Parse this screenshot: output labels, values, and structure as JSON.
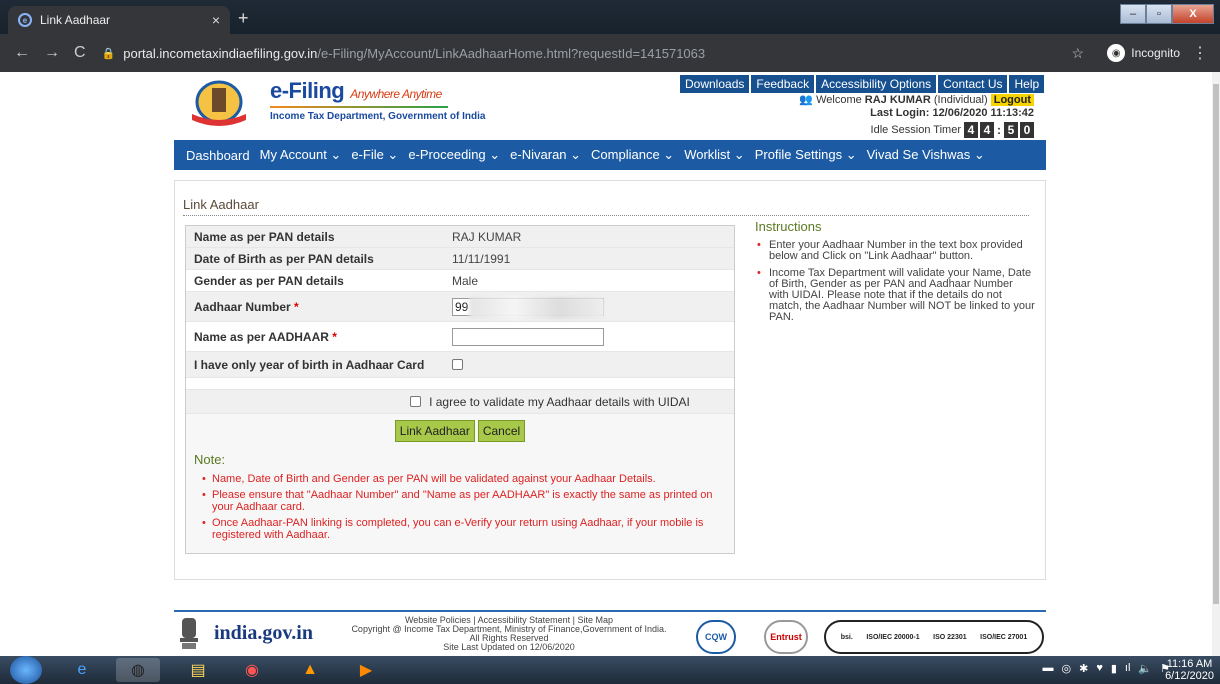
{
  "browser": {
    "tab_title": "Link Aadhaar",
    "tab_close": "×",
    "new_tab": "+",
    "url_domain": "portal.incometaxindiaefiling.gov.in",
    "url_path": "/e-Filing/MyAccount/LinkAadhaarHome.html?requestId=141571063",
    "incognito_label": "Incognito"
  },
  "header": {
    "brand_title": "e-Filing",
    "brand_tagline": "Anywhere Anytime",
    "brand_subtitle": "Income Tax Department, Government of India",
    "top_links": [
      "Downloads",
      "Feedback",
      "Accessibility Options",
      "Contact Us",
      "Help"
    ],
    "welcome_prefix": "Welcome",
    "user_name": "RAJ KUMAR",
    "user_type": "(Individual)",
    "logout_label": "Logout",
    "last_login": "Last Login: 12/06/2020 11:13:42",
    "idle_label": "Idle Session Timer",
    "timer_digits": [
      "4",
      "4",
      ":",
      "5",
      "0"
    ]
  },
  "nav": {
    "items": [
      "Dashboard",
      "My Account ⌄",
      "e-File ⌄",
      "e-Proceeding ⌄",
      "e-Nivaran ⌄",
      "Compliance ⌄",
      "Worklist ⌄",
      "Profile Settings ⌄",
      "Vivad Se Vishwas ⌄"
    ]
  },
  "content": {
    "title": "Link Aadhaar",
    "rows": [
      {
        "label": "Name as per PAN details",
        "value": "RAJ KUMAR"
      },
      {
        "label": "Date of Birth as per PAN details",
        "value": "11/11/1991"
      },
      {
        "label": "Gender as per PAN details",
        "value": "Male"
      }
    ],
    "aadhaar_label": "Aadhaar Number",
    "aadhaar_value": "99",
    "name_aadhaar_label": "Name as per AADHAAR",
    "yob_label": "I have only year of birth in Aadhaar Card",
    "agree_label": "I agree to validate my Aadhaar details with UIDAI",
    "link_button": "Link Aadhaar",
    "cancel_button": "Cancel",
    "note_title": "Note:",
    "notes": [
      "Name, Date of Birth and Gender as per PAN will be validated against your Aadhaar Details.",
      "Please ensure that \"Aadhaar Number\" and \"Name as per AADHAAR\" is exactly the same as printed on your Aadhaar card.",
      "Once Aadhaar-PAN linking is completed, you can e-Verify your return using Aadhaar, if your mobile is registered with Aadhaar."
    ],
    "instructions_title": "Instructions",
    "instructions": [
      "Enter your Aadhaar Number in the text box provided below and Click on \"Link Aadhaar\" button.",
      "Income Tax Department will validate your Name, Date of Birth, Gender as per PAN and Aadhaar Number with UIDAI. Please note that if the details do not match, the Aadhaar Number will NOT be linked to your PAN."
    ]
  },
  "footer": {
    "gov_site": "india.gov.in",
    "links": "Website Policies | Accessibility Statement | Site Map",
    "copyright": "Copyright @ Income Tax Department, Ministry of Finance,Government of India.",
    "rights": "All Rights Reserved",
    "updated": "Site Last Updated on 12/06/2020",
    "cert_cqw": "CQW",
    "cert_entrust": "Entrust",
    "cert_bsi": "bsi.",
    "cert_iso1": "ISO/IEC 20000-1",
    "cert_iso2": "ISO 22301",
    "cert_iso3": "ISO/IEC 27001"
  },
  "taskbar": {
    "time": "11:16 AM",
    "date": "6/12/2020"
  }
}
